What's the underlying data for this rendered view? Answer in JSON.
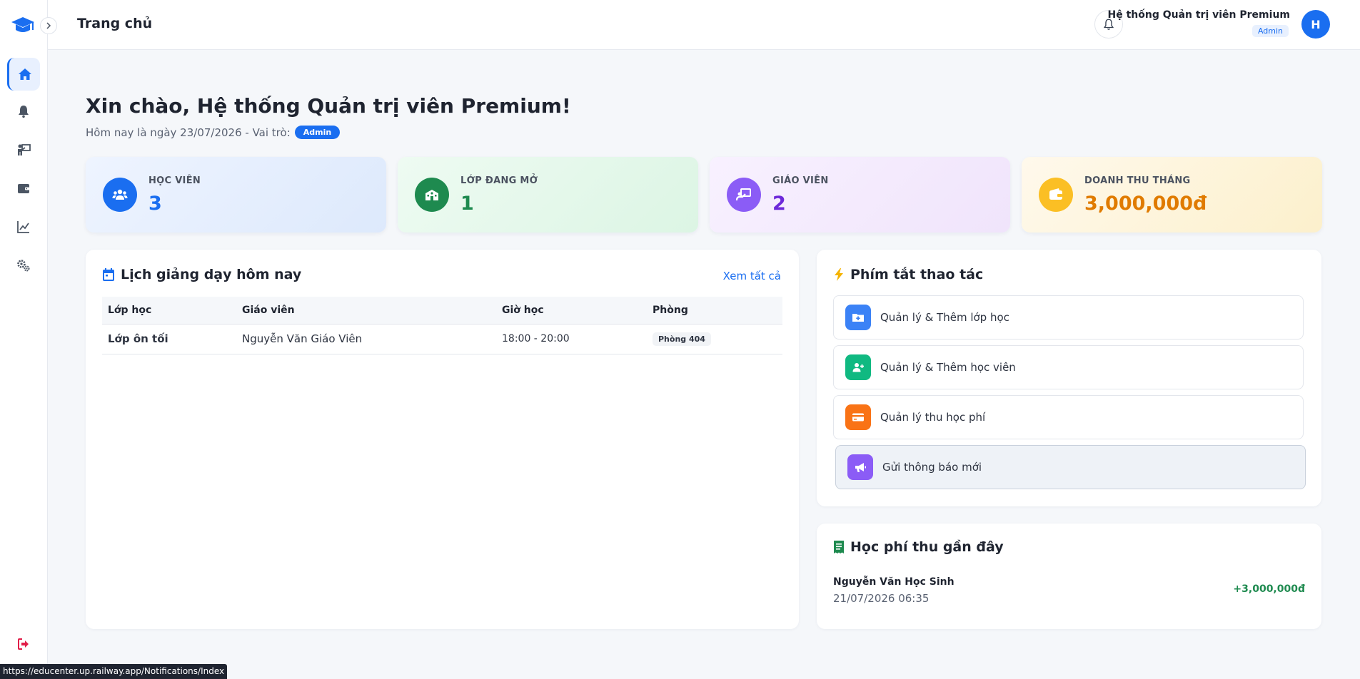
{
  "app": {
    "page_title": "Trang chủ"
  },
  "user": {
    "name": "Hệ thống Quản trị viên Premium",
    "role": "Admin",
    "avatar_initial": "H"
  },
  "sidebar": {
    "items": [
      {
        "icon": "home-icon",
        "active": true
      },
      {
        "icon": "bell-icon",
        "active": false
      },
      {
        "icon": "teacher-icon",
        "active": false
      },
      {
        "icon": "wallet-icon",
        "active": false
      },
      {
        "icon": "chart-line-icon",
        "active": false
      },
      {
        "icon": "gears-icon",
        "active": false
      }
    ],
    "logout_icon": "logout-icon"
  },
  "greeting": {
    "title": "Xin chào, Hệ thống Quản trị viên Premium!",
    "date_text": "Hôm nay là ngày 23/07/2026 - Vai trò:",
    "role_badge": "Admin"
  },
  "stats": [
    {
      "label": "HỌC VIÊN",
      "value": "3",
      "icon": "users-icon",
      "color": "#1a6ef0"
    },
    {
      "label": "LỚP ĐANG MỞ",
      "value": "1",
      "icon": "school-icon",
      "color": "#1e8a4f"
    },
    {
      "label": "GIÁO VIÊN",
      "value": "2",
      "icon": "chalkboard-teacher-icon",
      "color": "#7c3aed"
    },
    {
      "label": "DOANH THU THÁNG",
      "value": "3,000,000đ",
      "icon": "wallet-icon",
      "color": "#e07b00"
    }
  ],
  "schedule": {
    "title": "Lịch giảng dạy hôm nay",
    "view_all": "Xem tất cả",
    "columns": [
      "Lớp học",
      "Giáo viên",
      "Giờ học",
      "Phòng"
    ],
    "rows": [
      {
        "class": "Lớp ôn tối",
        "teacher": "Nguyễn Văn Giáo Viên",
        "time": "18:00 - 20:00",
        "room": "Phòng 404"
      }
    ]
  },
  "shortcuts": {
    "title": "Phím tắt thao tác",
    "items": [
      {
        "label": "Quản lý & Thêm lớp học",
        "icon": "folder-plus-icon",
        "color": "#3b82f6"
      },
      {
        "label": "Quản lý & Thêm học viên",
        "icon": "user-plus-icon",
        "color": "#10b981"
      },
      {
        "label": "Quản lý thu học phí",
        "icon": "credit-card-icon",
        "color": "#f97316"
      },
      {
        "label": "Gửi thông báo mới",
        "icon": "megaphone-icon",
        "color": "#8b5cf6"
      }
    ]
  },
  "recent_fees": {
    "title": "Học phí thu gần đây",
    "items": [
      {
        "name": "Nguyễn Văn Học Sinh",
        "datetime": "21/07/2026 06:35",
        "amount": "+3,000,000đ"
      }
    ]
  },
  "statusbar": {
    "url": "https://educenter.up.railway.app/Notifications/Index"
  }
}
